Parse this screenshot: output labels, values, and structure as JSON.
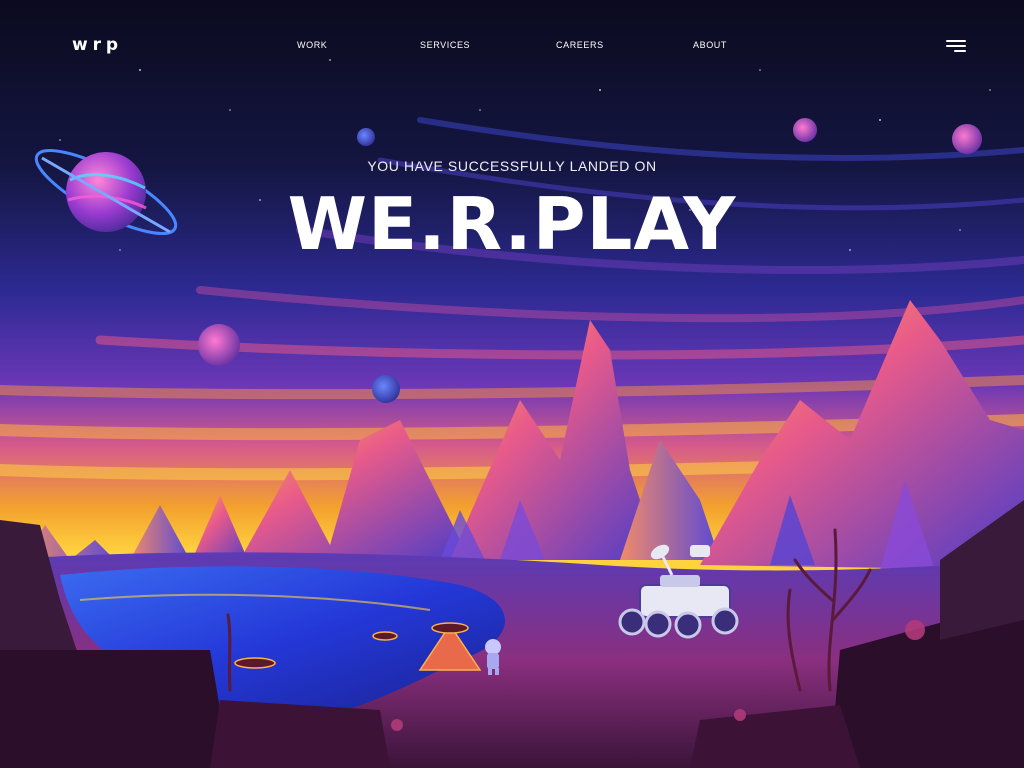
{
  "nav": {
    "logo": "w r p",
    "links": [
      "WORK",
      "SERVICES",
      "CAREERS",
      "ABOUT"
    ],
    "menu_icon": "hamburger-menu-icon"
  },
  "hero": {
    "subtitle": "YOU HAVE SUCCESSFULLY LANDED ON",
    "title": "WE.R.PLAY"
  },
  "colors": {
    "sky_top": "#0b0a1e",
    "sky_mid": "#2d2a93",
    "horizon_orange": "#f3a12e",
    "horizon_yellow": "#ffd23f",
    "mountain_purple": "#6c4fd8",
    "mountain_pink": "#e85a8a",
    "lake_blue": "#2438d8",
    "ground_pink": "#a2356f",
    "text": "#ffffff"
  }
}
